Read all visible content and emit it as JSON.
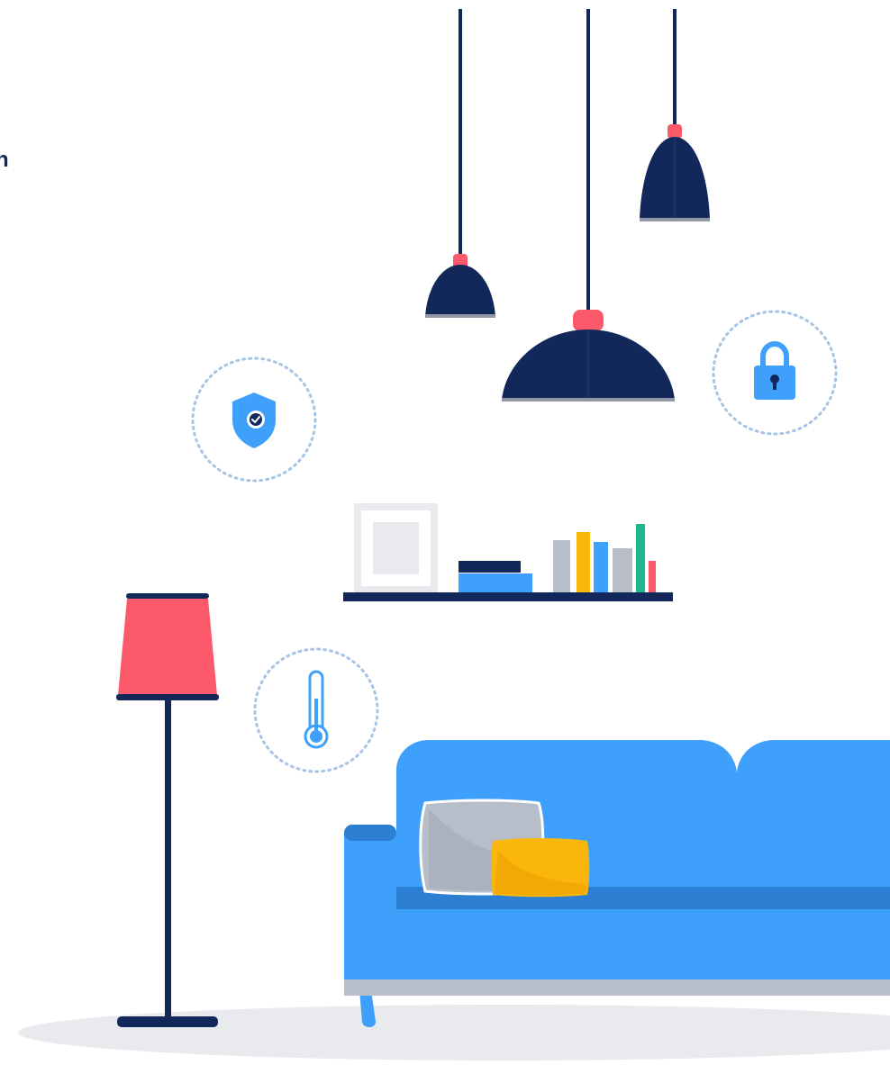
{
  "edge_text": "n",
  "icons": {
    "shield": "shield-check-icon",
    "lock": "padlock-icon",
    "thermometer": "thermometer-icon"
  },
  "colors": {
    "navy": "#13285a",
    "blue": "#3fa0fb",
    "dark_blue": "#2d7fd3",
    "coral": "#fc5a6b",
    "gray": "#b7bdc9",
    "light_gray": "#e8eaee",
    "yellow": "#fbb60b",
    "green": "#1fb78f",
    "dotted": "#a7c4e5"
  }
}
